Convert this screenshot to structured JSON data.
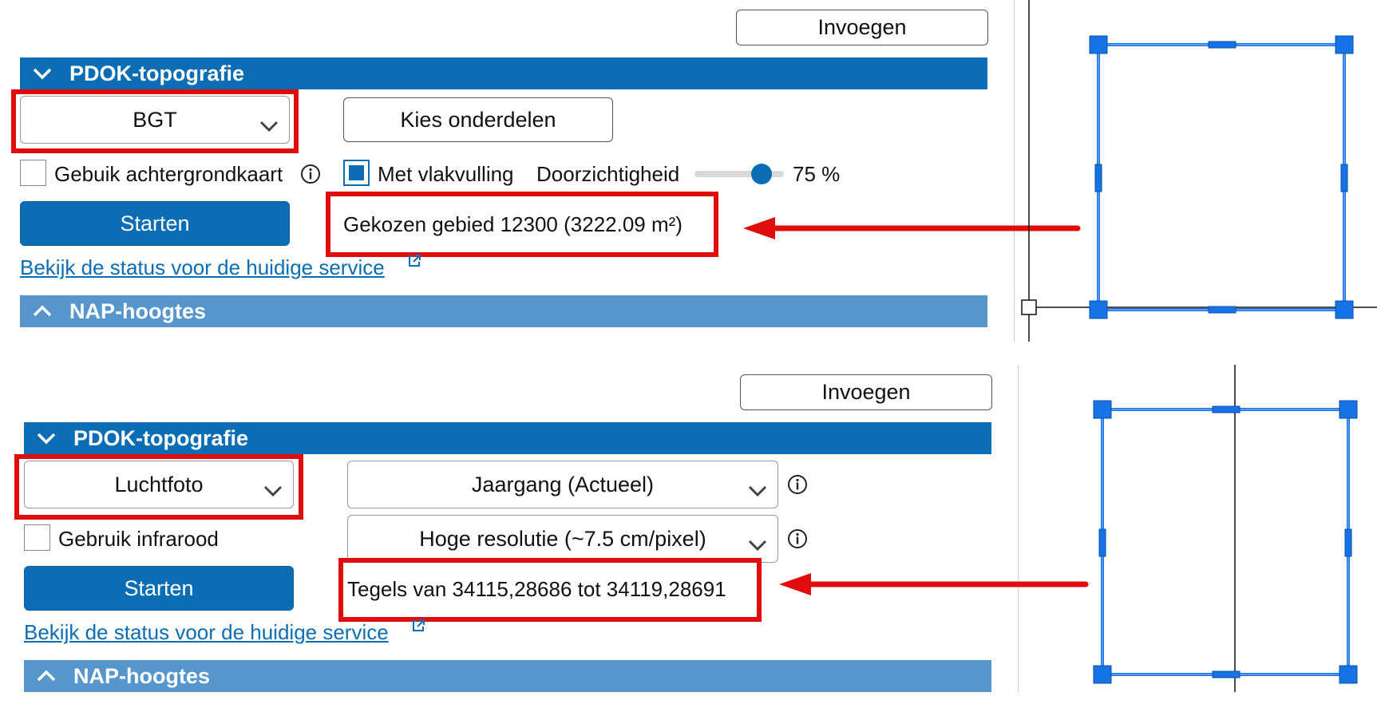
{
  "panel1": {
    "insert_button": "Invoegen",
    "section_title": "PDOK-topografie",
    "dataset_select": "BGT",
    "choose_parts_button": "Kies onderdelen",
    "use_background_label": "Gebuik achtergrondkaart",
    "area_fill_label": "Met vlakvulling",
    "transparency_label": "Doorzichtigheid",
    "transparency_value_text": "75 %",
    "transparency_value": 75,
    "start_button": "Starten",
    "info_text": "Gekozen gebied 12300 (3222.09 m²)",
    "status_link": "Bekijk de status voor de huidige service",
    "next_section_title": "NAP-hoogtes"
  },
  "panel2": {
    "insert_button": "Invoegen",
    "section_title": "PDOK-topografie",
    "dataset_select": "Luchtfoto",
    "year_select": "Jaargang (Actueel)",
    "use_infrared_label": "Gebruik infrarood",
    "resolution_select": "Hoge resolutie (~7.5 cm/pixel)",
    "start_button": "Starten",
    "info_text": "Tegels van 34115,28686 tot 34119,28691",
    "status_link": "Bekijk de status voor de huidige service",
    "next_section_title": "NAP-hoogtes"
  },
  "colors": {
    "primary": "#0b6db3",
    "section_light": "#5696cc",
    "highlight_red": "#e00d0d",
    "grip_blue": "#1673e6"
  },
  "icons": {
    "chevron": "chevron-down-icon",
    "chevron_up": "chevron-up-icon",
    "info": "info-icon",
    "external": "external-link-icon"
  }
}
